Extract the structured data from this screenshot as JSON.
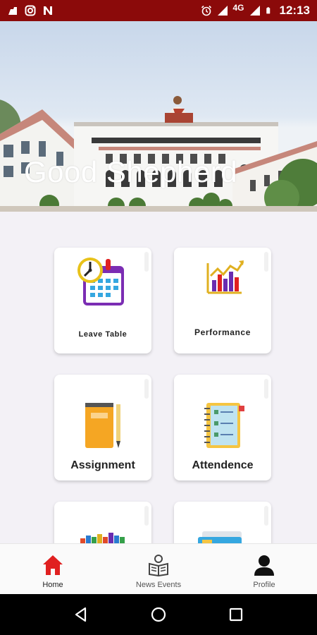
{
  "status_bar": {
    "time": "12:13",
    "network": "4G",
    "icons": [
      "notification-icon",
      "instagram-icon",
      "n-app-icon",
      "alarm-icon",
      "signal-icon",
      "battery-icon"
    ]
  },
  "hero": {
    "title": "Good Shepherd"
  },
  "tiles": [
    {
      "label": "Leave Table",
      "icon": "calendar-clock-icon"
    },
    {
      "label": "Performance",
      "icon": "performance-chart-icon"
    },
    {
      "label": "Assignment",
      "icon": "notebook-icon"
    },
    {
      "label": "Attendence",
      "icon": "attendance-register-icon"
    },
    {
      "label": "",
      "icon": "books-icon"
    },
    {
      "label": "",
      "icon": "cards-icon"
    }
  ],
  "bottom_nav": {
    "items": [
      {
        "label": "Home",
        "icon": "home-icon",
        "active": true
      },
      {
        "label": "News Events",
        "icon": "news-reader-icon",
        "active": false
      },
      {
        "label": "Profile",
        "icon": "profile-icon",
        "active": false
      }
    ]
  },
  "system_nav": [
    "back-icon",
    "home-circle-icon",
    "recents-icon"
  ],
  "colors": {
    "status_bar": "#8b0a0a",
    "accent": "#e02020",
    "background": "#f3f1f6"
  }
}
